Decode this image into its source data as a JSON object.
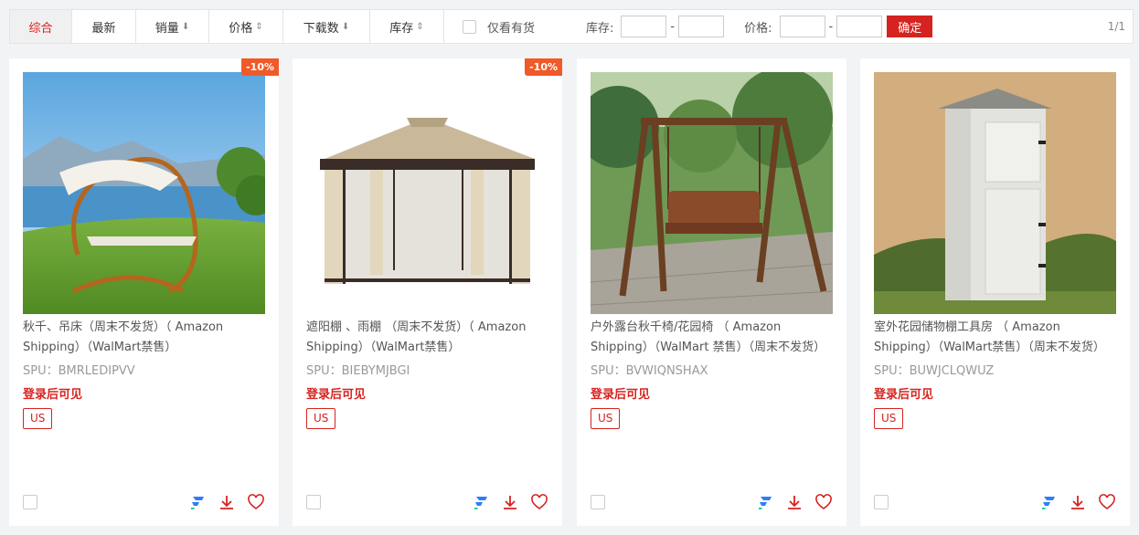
{
  "toolbar": {
    "sort_tabs": [
      {
        "label": "综合",
        "arrow": ""
      },
      {
        "label": "最新",
        "arrow": ""
      },
      {
        "label": "销量",
        "arrow": "⬇"
      },
      {
        "label": "价格",
        "arrow": "⇕"
      },
      {
        "label": "下载数",
        "arrow": "⬇"
      },
      {
        "label": "库存",
        "arrow": "⇕"
      }
    ],
    "in_stock_only_label": "仅看有货",
    "stock_label": "库存:",
    "price_label": "价格:",
    "range_separator": "-",
    "confirm_label": "确定",
    "pagination": "1/1"
  },
  "colors": {
    "accent": "#d6231f",
    "discount_badge": "#f05a28"
  },
  "products": [
    {
      "discount": "-10%",
      "title": "秋千、吊床（周末不发货）（ Amazon Shipping）（WalMart禁售）",
      "spu": "SPU：BMRLEDIPVV",
      "login_notice": "登录后可见",
      "country": "US",
      "image": "hammock-photo"
    },
    {
      "discount": "-10%",
      "title": "遮阳棚 、雨棚 （周末不发货）（ Amazon Shipping）（WalMart禁售）",
      "spu": "SPU：BIEBYMJBGI",
      "login_notice": "登录后可见",
      "country": "US",
      "image": "gazebo-photo"
    },
    {
      "discount": "",
      "title": "户外露台秋千椅/花园椅 （ Amazon Shipping）（WalMart 禁售）（周末不发货）",
      "spu": "SPU：BVWIQNSHAX",
      "login_notice": "登录后可见",
      "country": "US",
      "image": "swing-chair-photo"
    },
    {
      "discount": "",
      "title": "室外花园储物棚工具房 （ Amazon Shipping）（WalMart禁售）（周末不发货）",
      "spu": "SPU：BUWJCLQWUZ",
      "login_notice": "登录后可见",
      "country": "US",
      "image": "garden-shed-photo"
    }
  ]
}
